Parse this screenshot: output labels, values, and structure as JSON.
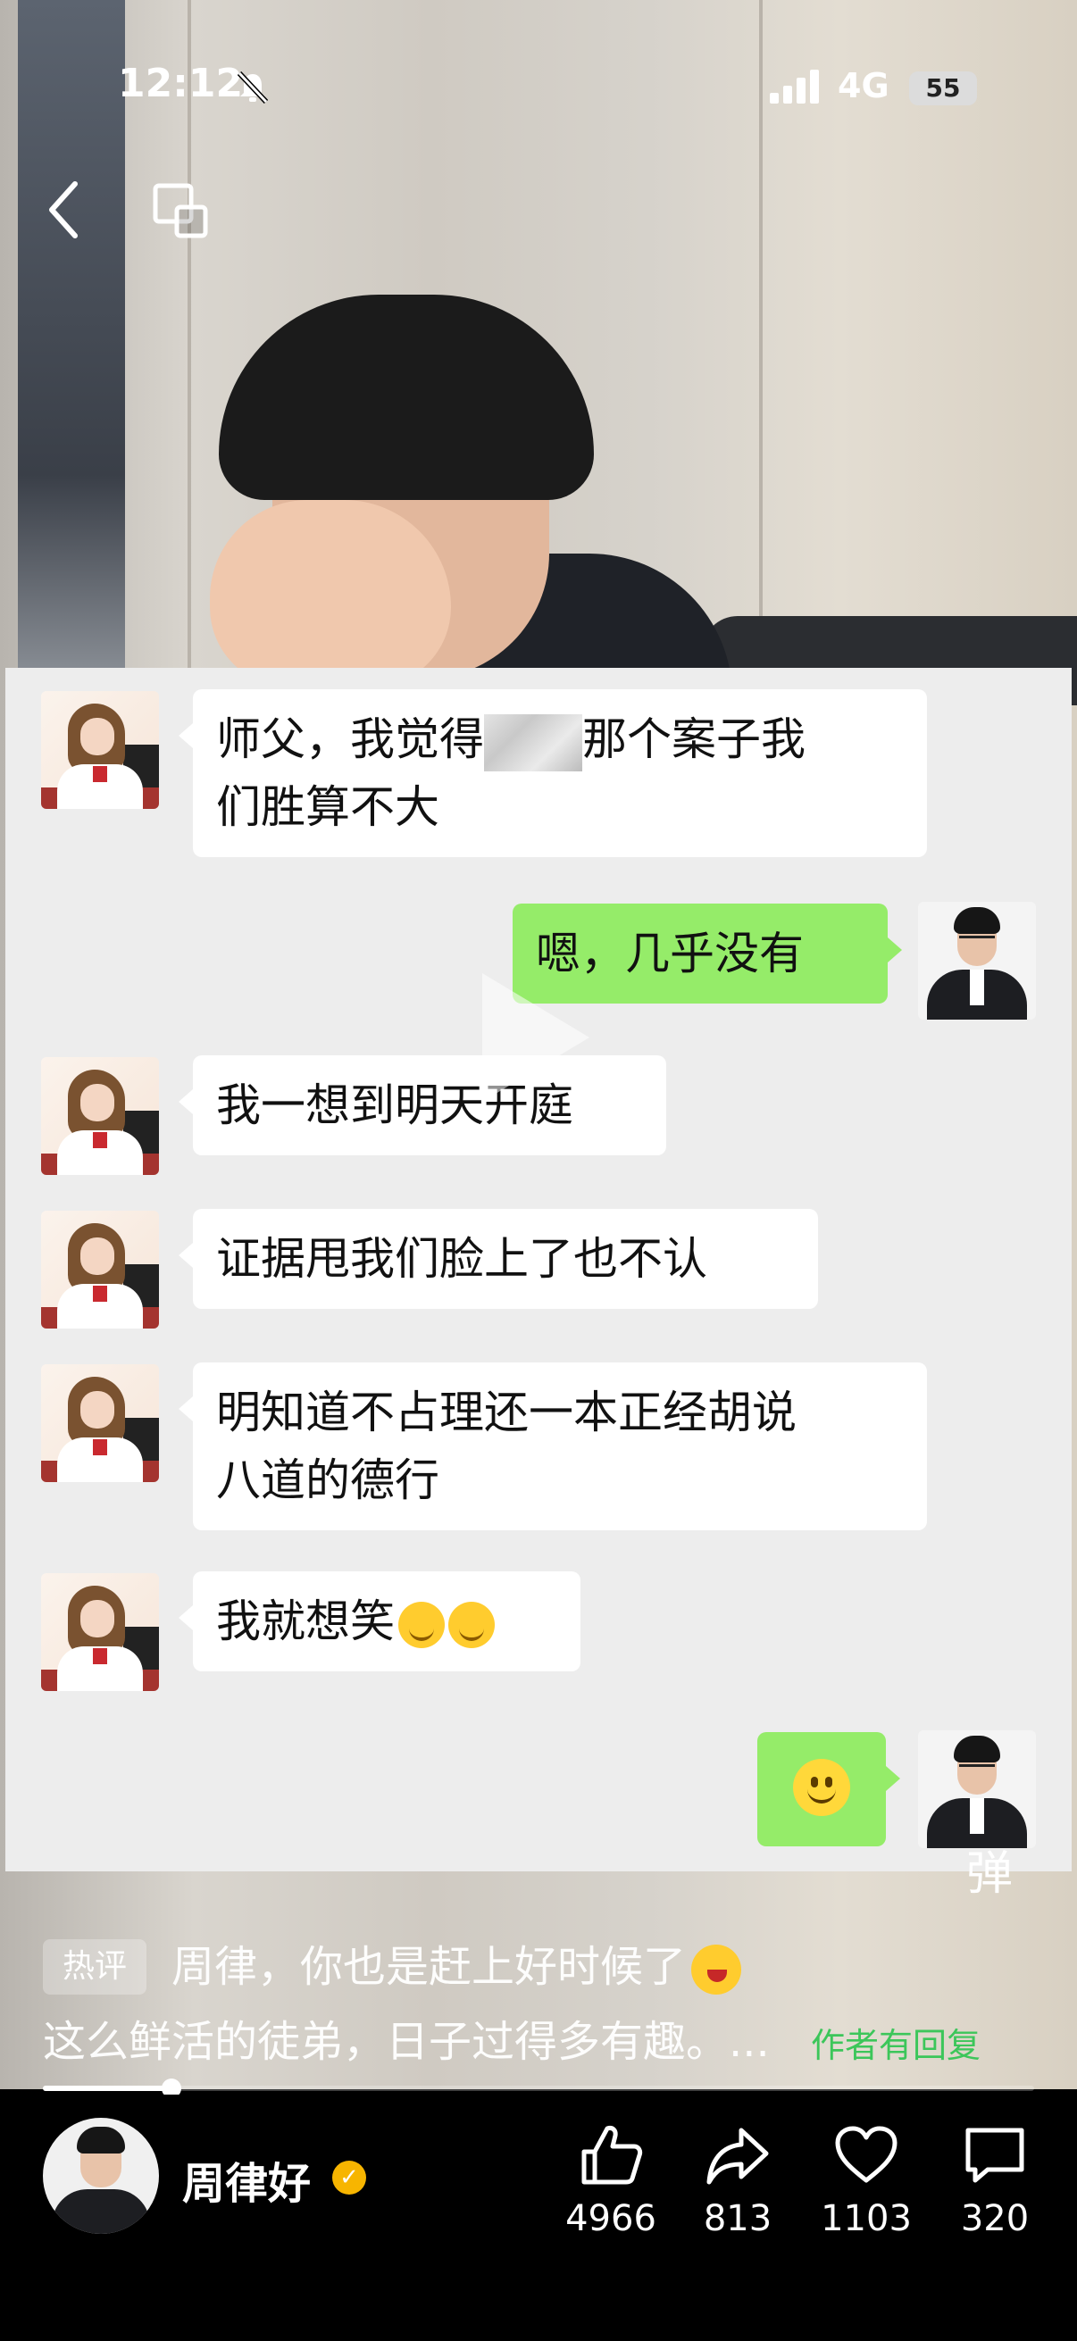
{
  "status_bar": {
    "time": "12:12",
    "network": "4G",
    "battery": "55"
  },
  "chat": {
    "messages": [
      {
        "from": "apprentice",
        "text_before": "师父，我觉得",
        "text_after": "那个案子我",
        "line2": "们胜算不大"
      },
      {
        "from": "master",
        "text": "嗯，几乎没有"
      },
      {
        "from": "apprentice",
        "text": "我一想到明天开庭"
      },
      {
        "from": "apprentice",
        "text": "证据甩我们脸上了也不认"
      },
      {
        "from": "apprentice",
        "text": "明知道不占理还一本正经胡说",
        "line2": "八道的德行"
      },
      {
        "from": "apprentice",
        "text": "我就想笑"
      },
      {
        "from": "master",
        "emoji": "smile-emoji"
      }
    ]
  },
  "danmaku": {
    "label": "弹"
  },
  "hot_comment": {
    "badge": "热评",
    "line1": "周律，你也是赶上好时候了",
    "line2": "这么鲜活的徒弟，日子过得多有趣。...",
    "author_reply": "作者有回复"
  },
  "progress": {
    "fraction": 0.13
  },
  "author": {
    "name": "周律好"
  },
  "actions": {
    "like": {
      "count": "4966",
      "icon": "thumbs-up-icon"
    },
    "share": {
      "count": "813",
      "icon": "share-arrow-icon"
    },
    "favorite": {
      "count": "1103",
      "icon": "heart-icon"
    },
    "comment": {
      "count": "320",
      "icon": "comment-bubble-icon"
    }
  }
}
